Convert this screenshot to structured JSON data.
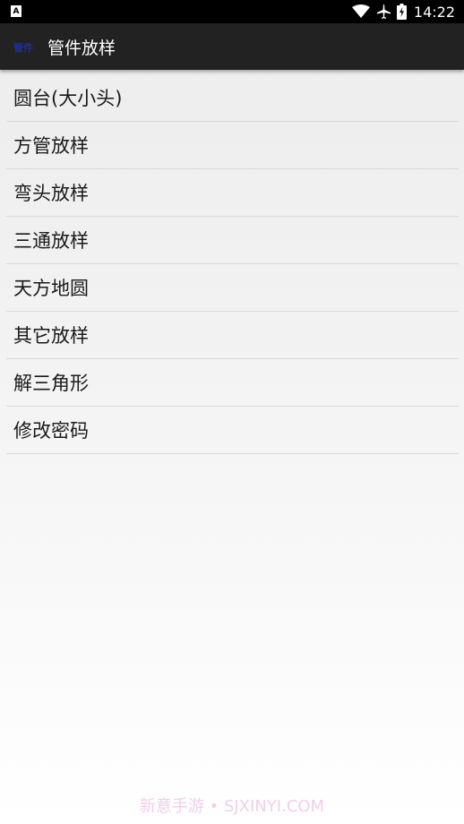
{
  "status_bar": {
    "notification_icon_letter": "A",
    "time": "14:22",
    "icons": [
      "wifi-icon",
      "airplane-icon",
      "battery-icon"
    ]
  },
  "app_bar": {
    "icon_text": "管件",
    "title": "管件放样"
  },
  "menu": {
    "items": [
      {
        "label": "圆台(大小头)"
      },
      {
        "label": "方管放样"
      },
      {
        "label": "弯头放样"
      },
      {
        "label": "三通放样"
      },
      {
        "label": "天方地圆"
      },
      {
        "label": "其它放样"
      },
      {
        "label": "解三角形"
      },
      {
        "label": "修改密码"
      }
    ]
  },
  "watermark": "新意手游 • SJXINYI.COM",
  "colors": {
    "app_bar_bg": "#222222",
    "status_bar_bg": "#000000",
    "divider": "#d8d8d8",
    "app_icon_text": "#1f2f9c"
  }
}
